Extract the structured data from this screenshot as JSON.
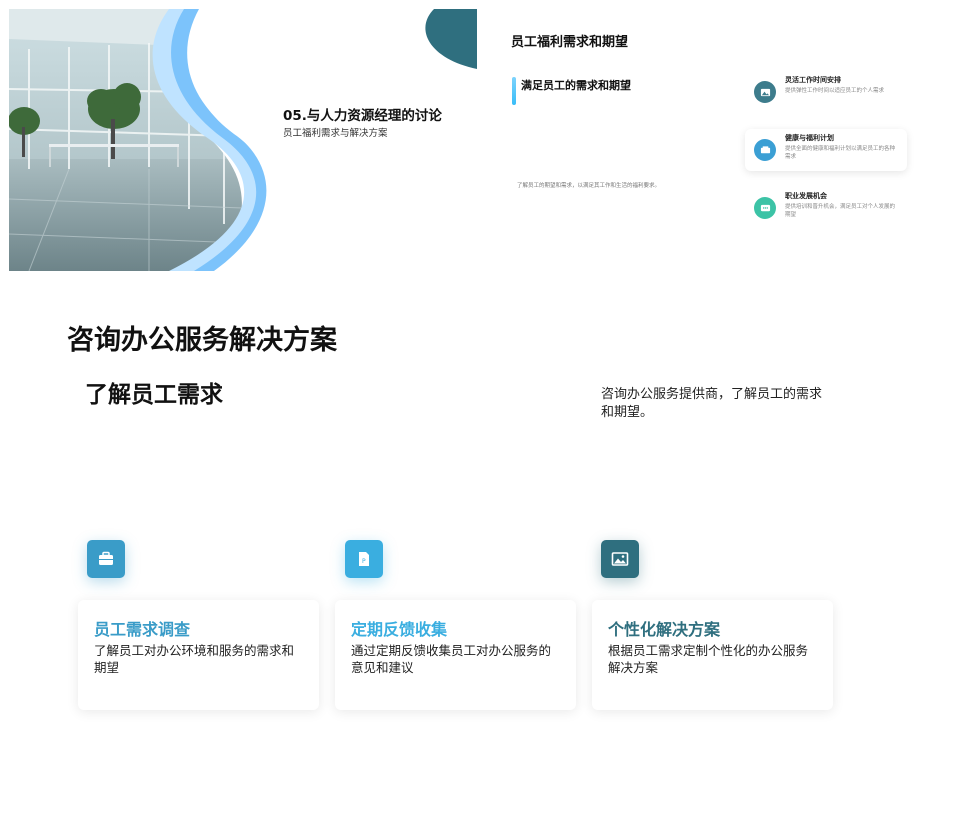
{
  "slide1": {
    "title": "05.与人力资源经理的讨论",
    "subtitle": "员工福利需求与解决方案",
    "colors": {
      "wave_light": "#bfe3ff",
      "wave_mid": "#7cc3fb",
      "wave_dark": "#4aa5f0",
      "corner": "#2f6f7f"
    }
  },
  "slide2": {
    "title": "员工福利需求和期望",
    "subtitle": "满足员工的需求和期望",
    "description": "了解员工的期望和需求，以满足其工作和生活的福利要求。",
    "items": [
      {
        "icon": "image-icon",
        "title": "灵活工作时间安排",
        "desc": "提供弹性工作时间以适应员工的个人需求",
        "color": "#3d7c8c"
      },
      {
        "icon": "card-icon",
        "title": "健康与福利计划",
        "desc": "提供全面的健康和福利计划以满足员工的各种需求",
        "color": "#3b9fd4"
      },
      {
        "icon": "chat-icon",
        "title": "职业发展机会",
        "desc": "提供培训和晋升机会，满足员工对个人发展的期望",
        "color": "#3cc3a6"
      }
    ]
  },
  "slide3": {
    "title": "咨询办公服务解决方案",
    "subtitle": "了解员工需求",
    "intro": "咨询办公服务提供商，了解员工的需求和期望。",
    "cards": [
      {
        "icon": "briefcase-icon",
        "title": "员工需求调查",
        "desc": "了解员工对办公环境和服务的需求和期望",
        "color": "#3a9cc8"
      },
      {
        "icon": "presentation-icon",
        "title": "定期反馈收集",
        "desc": "通过定期反馈收集员工对办公服务的意见和建议",
        "color": "#3aaee0"
      },
      {
        "icon": "image-icon",
        "title": "个性化解决方案",
        "desc": "根据员工需求定制个性化的办公服务解决方案",
        "color": "#2f6f7f"
      }
    ]
  }
}
